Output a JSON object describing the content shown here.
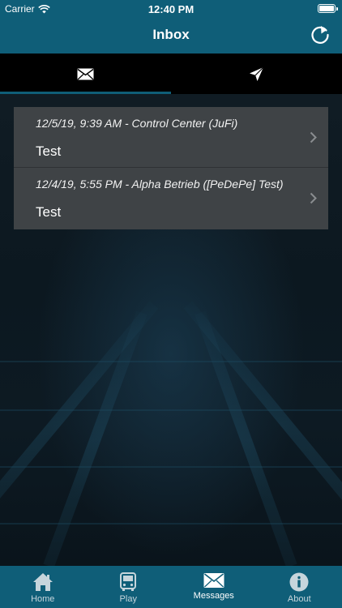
{
  "status_bar": {
    "carrier": "Carrier",
    "time": "12:40 PM"
  },
  "header": {
    "title": "Inbox"
  },
  "tabs": [
    {
      "icon": "envelope-icon",
      "active": true
    },
    {
      "icon": "paper-plane-icon",
      "active": false
    }
  ],
  "messages": [
    {
      "meta": "12/5/19, 9:39 AM - Control Center (JuFi)",
      "subject": "Test"
    },
    {
      "meta": "12/4/19, 5:55 PM - Alpha Betrieb ([PeDePe] Test)",
      "subject": "Test"
    }
  ],
  "tabbar": [
    {
      "label": "Home",
      "icon": "home-icon"
    },
    {
      "label": "Play",
      "icon": "bus-icon"
    },
    {
      "label": "Messages",
      "icon": "envelope-icon",
      "active": true
    },
    {
      "label": "About",
      "icon": "info-icon"
    }
  ],
  "colors": {
    "accent": "#0f5e78",
    "card": "#3f4346",
    "tab_bg": "#000000"
  }
}
